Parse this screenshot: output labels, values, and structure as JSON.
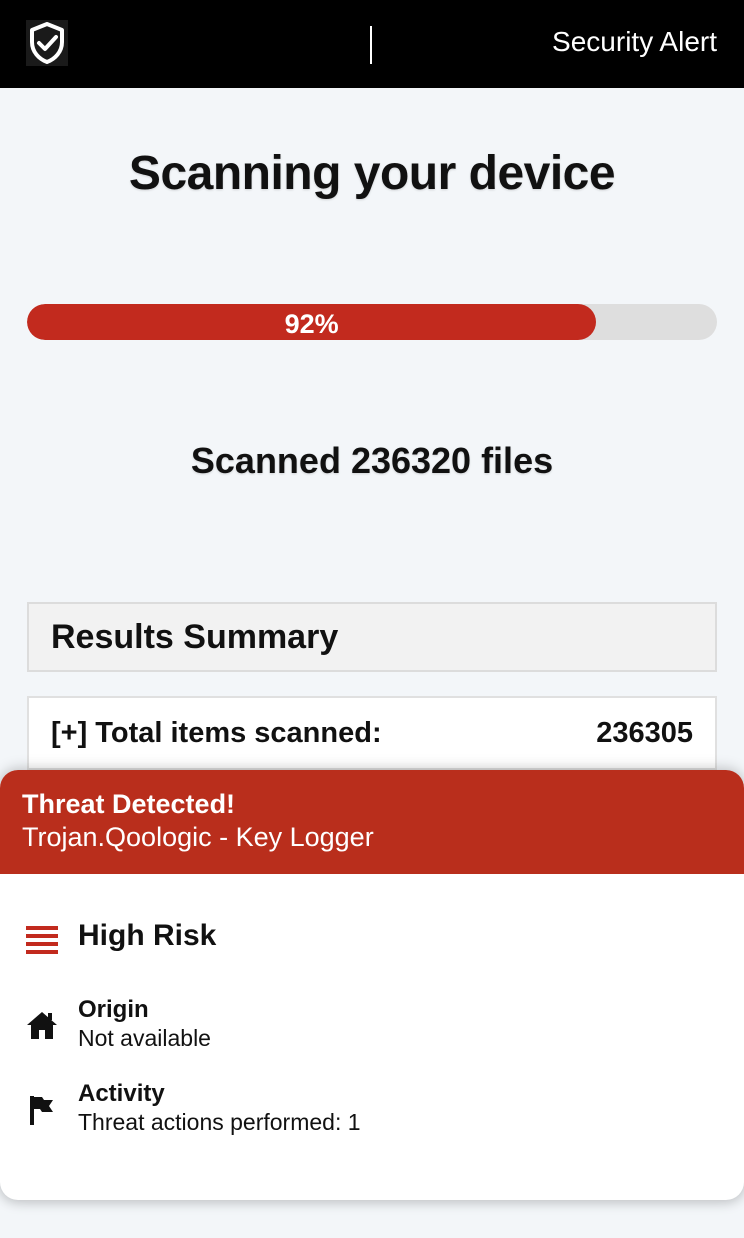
{
  "header": {
    "logo_icon": "shield-check-icon",
    "title": "Security Alert"
  },
  "scan": {
    "title": "Scanning your device",
    "progress_percent": 82.5,
    "progress_label": "92%",
    "scanned_text": "Scanned 236320 files"
  },
  "summary": {
    "heading": "Results Summary",
    "rows": [
      {
        "label": "[+] Total items scanned:",
        "value": "236305"
      }
    ]
  },
  "threat": {
    "heading": "Threat Detected!",
    "name": "Trojan.Qoologic - Key Logger",
    "risk": {
      "icon": "risk-bars-icon",
      "label": "High Risk"
    },
    "origin": {
      "icon": "home-icon",
      "title": "Origin",
      "value": "Not available"
    },
    "activity": {
      "icon": "flag-icon",
      "title": "Activity",
      "value": "Threat actions performed: 1"
    }
  },
  "colors": {
    "accent_red": "#c22a1e",
    "banner_red": "#b92e1c",
    "header_bg": "#000000",
    "page_bg": "#f3f6f9"
  }
}
